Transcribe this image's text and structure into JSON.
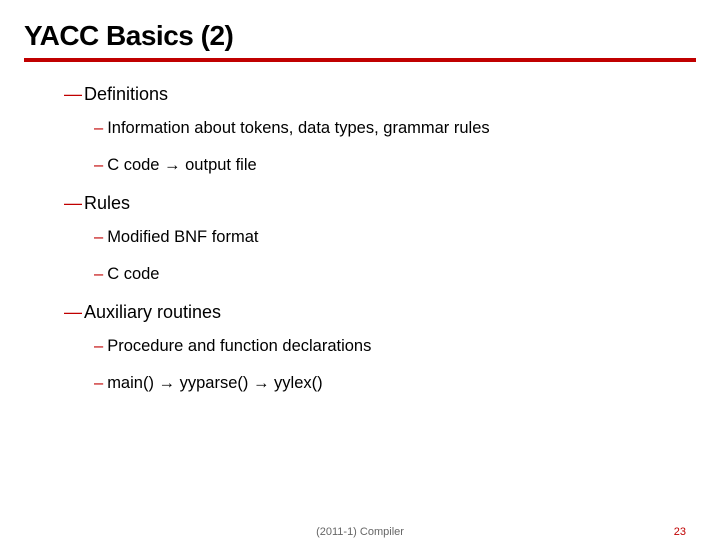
{
  "title": "YACC Basics (2)",
  "sections": [
    {
      "heading": "Definitions",
      "items": [
        "Information about tokens, data types, grammar rules",
        "C code → output file"
      ]
    },
    {
      "heading": "Rules",
      "items": [
        "Modified BNF format",
        "C code"
      ]
    },
    {
      "heading": "Auxiliary routines",
      "items": [
        "Procedure and function declarations",
        "main() → yyparse() → yylex()"
      ]
    }
  ],
  "footer": {
    "center": "(2011-1) Compiler",
    "page": "23"
  }
}
